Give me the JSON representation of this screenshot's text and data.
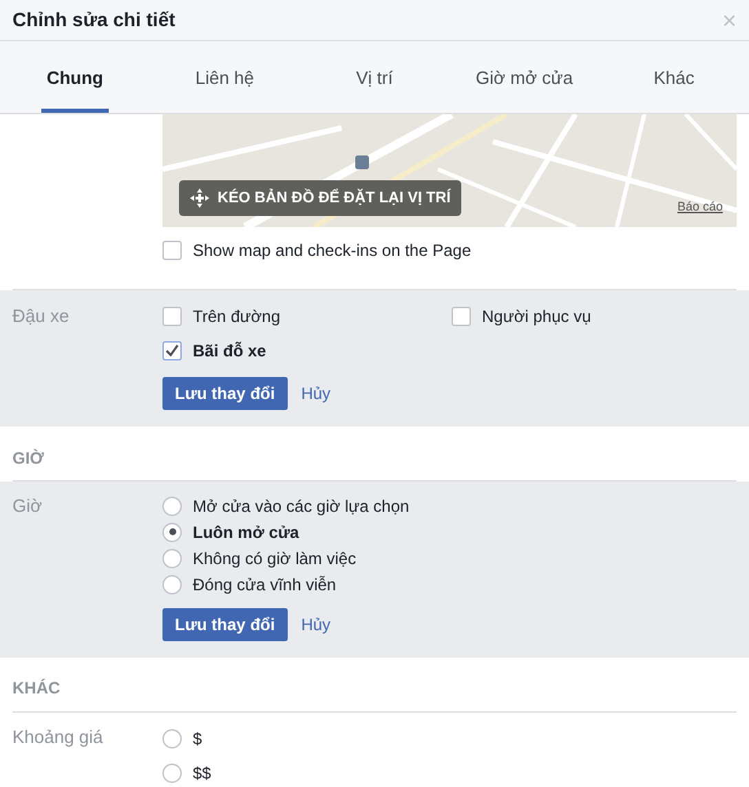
{
  "window": {
    "title": "Chỉnh sửa chi tiết",
    "close": "×"
  },
  "tabs": [
    {
      "label": "Chung",
      "selected": true
    },
    {
      "label": "Liên hệ",
      "selected": false
    },
    {
      "label": "Vị trí",
      "selected": false
    },
    {
      "label": "Giờ mở cửa",
      "selected": false
    },
    {
      "label": "Khác",
      "selected": false
    }
  ],
  "map": {
    "drag_button": "KÉO BẢN ĐỒ ĐỂ ĐẶT LẠI VỊ TRÍ",
    "report_link": "Báo cáo"
  },
  "show_map": {
    "label": "Show map and check-ins on the Page",
    "checked": false
  },
  "parking": {
    "label": "Đậu xe",
    "options": [
      {
        "label": "Trên đường",
        "checked": false
      },
      {
        "label": "Người phục vụ",
        "checked": false
      },
      {
        "label": "Bãi đỗ xe",
        "checked": true
      }
    ],
    "save": "Lưu thay đổi",
    "cancel": "Hủy"
  },
  "hours_section": {
    "heading": "GIỜ",
    "label": "Giờ",
    "options": [
      {
        "label": "Mở cửa vào các giờ lựa chọn",
        "selected": false
      },
      {
        "label": "Luôn mở cửa",
        "selected": true
      },
      {
        "label": "Không có giờ làm việc",
        "selected": false
      },
      {
        "label": "Đóng cửa vĩnh viễn",
        "selected": false
      }
    ],
    "save": "Lưu thay đổi",
    "cancel": "Hủy"
  },
  "other_section": {
    "heading": "KHÁC",
    "label": "Khoảng giá",
    "options": [
      {
        "label": "$",
        "selected": false
      },
      {
        "label": "$$",
        "selected": false
      }
    ]
  }
}
